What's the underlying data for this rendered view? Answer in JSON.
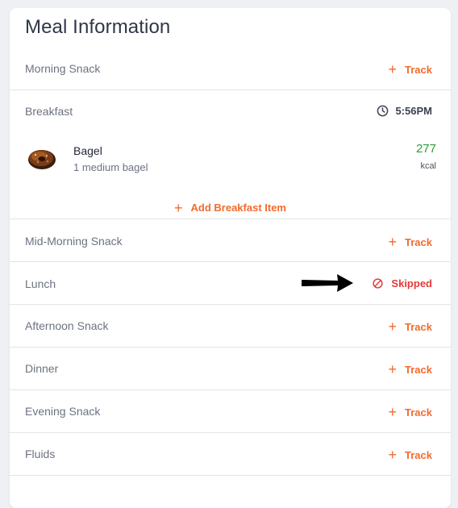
{
  "card": {
    "title": "Meal Information"
  },
  "meals": {
    "morning_snack": {
      "label": "Morning Snack",
      "action": "Track"
    },
    "breakfast": {
      "label": "Breakfast",
      "time": "5:56PM",
      "items": [
        {
          "name": "Bagel",
          "portion": "1 medium bagel",
          "calories": "277",
          "unit": "kcal",
          "icon": "bagel-icon"
        }
      ],
      "add_label": "Add Breakfast Item"
    },
    "mid_morning_snack": {
      "label": "Mid-Morning Snack",
      "action": "Track"
    },
    "lunch": {
      "label": "Lunch",
      "action": "Skipped",
      "status": "skipped"
    },
    "afternoon_snack": {
      "label": "Afternoon Snack",
      "action": "Track"
    },
    "dinner": {
      "label": "Dinner",
      "action": "Track"
    },
    "evening_snack": {
      "label": "Evening Snack",
      "action": "Track"
    },
    "fluids": {
      "label": "Fluids",
      "action": "Track"
    }
  },
  "icons": {
    "plus": "+",
    "clock": "clock-icon",
    "skip": "prohibit-icon",
    "annotation": "arrow-right-icon"
  },
  "colors": {
    "accent": "#f26a2e",
    "skipped": "#e53b3b",
    "calories": "#2e9a3a",
    "title": "#2f3747"
  },
  "plus_glyph": "+"
}
